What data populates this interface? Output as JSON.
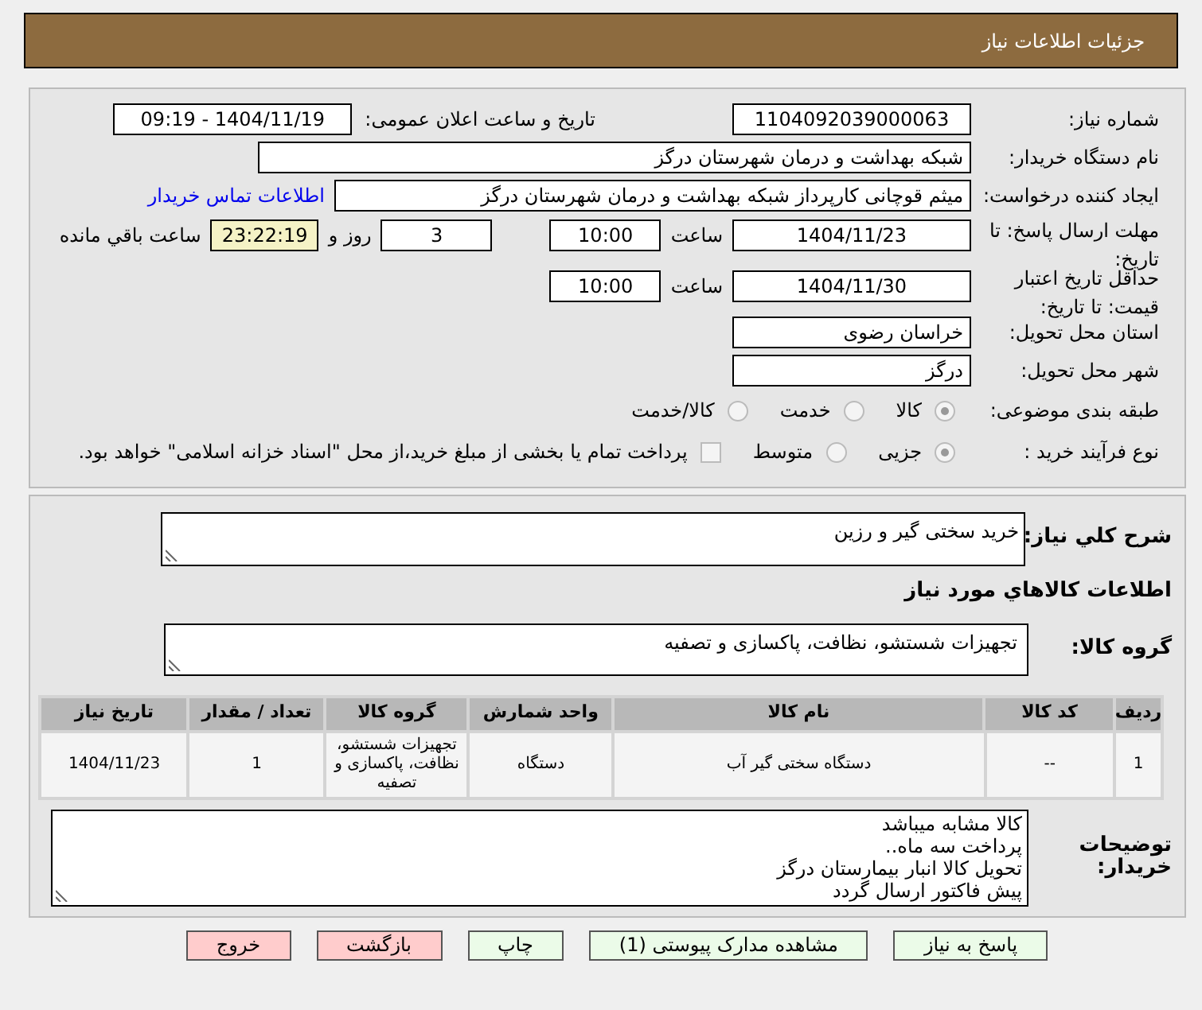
{
  "header": {
    "title": "جزئیات اطلاعات نیاز"
  },
  "need_number": {
    "label": "شماره نیاز:",
    "value": "1104092039000063"
  },
  "announce": {
    "label": "تاریخ و ساعت اعلان عمومی:",
    "value": "1404/11/19 - 09:19"
  },
  "buyer_org": {
    "label": "نام دستگاه خریدار:",
    "value": "شبکه بهداشت و درمان شهرستان درگز"
  },
  "requester": {
    "label": "ایجاد کننده درخواست:",
    "value": "میثم قوچانی کارپرداز شبکه بهداشت و درمان شهرستان درگز",
    "link": "اطلاعات تماس خریدار"
  },
  "deadline": {
    "label": "مهلت ارسال پاسخ: تا تاریخ:",
    "date": "1404/11/23",
    "time_label": "ساعت",
    "time": "10:00",
    "days": "3",
    "days_label": "روز و",
    "remaining": "23:22:19",
    "remaining_label": "ساعت باقي مانده"
  },
  "validity": {
    "label": "حداقل تاریخ اعتبار قیمت: تا تاریخ:",
    "date": "1404/11/30",
    "time_label": "ساعت",
    "time": "10:00"
  },
  "province": {
    "label": "استان محل تحویل:",
    "value": "خراسان رضوی"
  },
  "city": {
    "label": "شهر محل تحویل:",
    "value": "درگز"
  },
  "category": {
    "label": "طبقه بندی موضوعی:",
    "options": [
      {
        "label": "کالا",
        "selected": true
      },
      {
        "label": "خدمت",
        "selected": false
      },
      {
        "label": "کالا/خدمت",
        "selected": false
      }
    ]
  },
  "process": {
    "label": "نوع فرآیند خرید :",
    "options": [
      {
        "label": "جزیی",
        "selected": true
      },
      {
        "label": "متوسط",
        "selected": false
      }
    ],
    "checkbox": {
      "label": "پرداخت تمام یا بخشی از مبلغ خرید،از محل \"اسناد خزانه اسلامی\" خواهد بود.",
      "checked": false
    }
  },
  "description": {
    "label": "شرح کلي نیاز:",
    "value": "خرید سختی گیر و رزین"
  },
  "goods_title": "اطلاعات کالاهاي مورد نیاز",
  "goods_group": {
    "label": "گروه کالا:",
    "value": "تجهیزات شستشو، نظافت، پاکسازی و تصفیه"
  },
  "table": {
    "columns": [
      "ردیف",
      "کد کالا",
      "نام کالا",
      "واحد شمارش",
      "گروه کالا",
      "تعداد / مقدار",
      "تاریخ نیاز"
    ],
    "rows": [
      [
        "1",
        "--",
        "دستگاه سختی گیر آب",
        "دستگاه",
        "تجهیزات شستشو، نظافت، پاکسازی و تصفیه",
        "1",
        "1404/11/23"
      ]
    ]
  },
  "buyer_notes": {
    "label": "توضیحات خریدار:",
    "lines": [
      "کالا مشابه میباشد",
      "پرداخت سه ماه..",
      "تحویل کالا انبار بیمارستان درگز",
      "پیش فاکتور ارسال گردد"
    ]
  },
  "buttons": [
    {
      "label": "پاسخ به نیاز",
      "kind": "green"
    },
    {
      "label": "مشاهده مدارک پیوستی (1)",
      "kind": "green"
    },
    {
      "label": "چاپ",
      "kind": "green"
    },
    {
      "label": "بازگشت",
      "kind": "red"
    },
    {
      "label": "خروج",
      "kind": "red"
    }
  ]
}
